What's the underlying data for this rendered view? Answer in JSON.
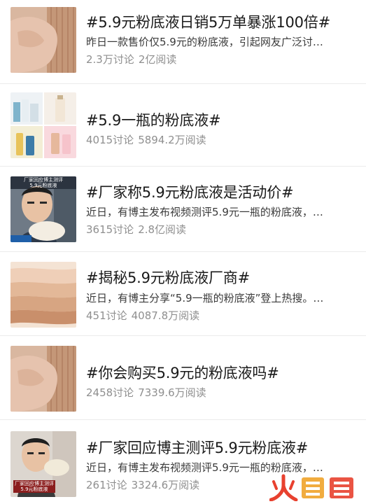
{
  "topics": [
    {
      "title": "#5.9元粉底液日销5万单暴涨100倍#",
      "desc": "昨日一款售价仅5.9元的粉底液，引起网友广泛讨…",
      "discuss": "2.3万讨论",
      "reads": "2亿阅读",
      "thumb_icon": "hand-swatch-thumbnail"
    },
    {
      "title": "#5.9一瓶的粉底液#",
      "desc": "",
      "discuss": "4015讨论",
      "reads": "5894.2万阅读",
      "thumb_icon": "product-collage-thumbnail"
    },
    {
      "title": "#厂家称5.9元粉底液是活动价#",
      "desc": "近日，有博主发布视频测评5.9元一瓶的粉底液，…",
      "discuss": "3615讨论",
      "reads": "2.8亿阅读",
      "thumb_icon": "blogger-video-thumbnail",
      "thumb_caption_top": "厂家回应博主测评",
      "thumb_caption_sub": "5.9元粉底液"
    },
    {
      "title": "#揭秘5.9元粉底液厂商#",
      "desc": "近日，有博主分享“5.9一瓶的粉底液”登上热搜。…",
      "discuss": "451讨论",
      "reads": "4087.8万阅读",
      "thumb_icon": "foundation-swatches-thumbnail"
    },
    {
      "title": "#你会购买5.9元的粉底液吗#",
      "desc": "",
      "discuss": "2458讨论",
      "reads": "7339.6万阅读",
      "thumb_icon": "hand-swatch-thumbnail"
    },
    {
      "title": "#厂家回应博主测评5.9元粉底液#",
      "desc": "近日，有博主发布视频测评5.9元一瓶的粉底液，…",
      "discuss": "261讨论",
      "reads": "3324.6万阅读",
      "thumb_icon": "blogger-video-thumbnail",
      "thumb_caption_top": "厂家回应博主测评",
      "thumb_caption_sub": "5.9元粉底液"
    }
  ],
  "watermark": {
    "text": "火鲤鱼",
    "icon": "huoliyu-logo",
    "colors": [
      "#e8412f",
      "#f0a32a",
      "#e8412f"
    ]
  },
  "colors": {
    "title": "#1a1a1a",
    "desc": "#3a3a3a",
    "stats": "#8f8f8f",
    "divider": "#ebebeb"
  }
}
